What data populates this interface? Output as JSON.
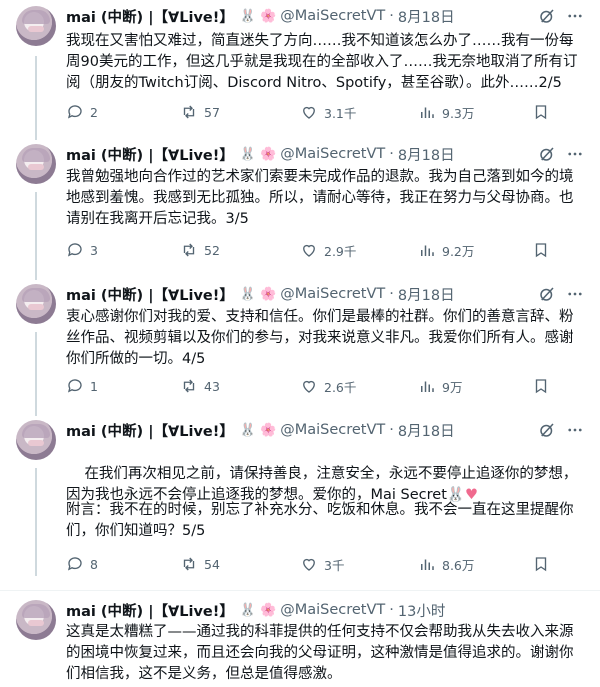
{
  "author": {
    "name": "mai (中断) |【∀Live!】",
    "rabbit_emoji": "🐰",
    "flower_emoji": "🌸",
    "handle": "@MaiSecretVT"
  },
  "tweets": [
    {
      "date": "8月18日",
      "text": "我现在又害怕又难过，简直迷失了方向……我不知道该怎么办了……我有一份每周90美元的工作，但这几乎就是我现在的全部收入了……我无奈地取消了所有订阅（朋友的Twitch订阅、Discord Nitro、Spotify，甚至谷歌）。此外……2/5",
      "replies": "2",
      "retweets": "57",
      "likes": "3.1千",
      "views": "9.3万"
    },
    {
      "date": "8月18日",
      "text": "我曾勉强地向合作过的艺术家们索要未完成作品的退款。我为自己落到如今的境地感到羞愧。我感到无比孤独。所以，请耐心等待，我正在努力与父母协商。也请别在我离开后忘记我。3/5",
      "replies": "3",
      "retweets": "52",
      "likes": "2.9千",
      "views": "9.2万"
    },
    {
      "date": "8月18日",
      "text": "衷心感谢你们对我的爱、支持和信任。你们是最棒的社群。你们的善意言辞、粉丝作品、视频剪辑以及你们的参与，对我来说意义非凡。我爱你们所有人。感谢你们所做的一切。4/5",
      "replies": "1",
      "retweets": "43",
      "likes": "2.6千",
      "views": "9万"
    },
    {
      "date": "8月18日",
      "text_line1": "在我们再次相见之前，请保持善良，注意安全，永远不要停止追逐你的梦想，因为我也永远不会停止追逐我的梦想。爱你的，Mai Secret",
      "text_emoji": "🐰",
      "text_heart": "♥",
      "text_line2": "附言：我不在的时候，别忘了补充水分、吃饭和休息。我不会一直在这里提醒你们，你们知道吗？5/5",
      "replies": "8",
      "retweets": "54",
      "likes": "3千",
      "views": "8.6万"
    },
    {
      "date": "13小时",
      "text": "这真是太糟糕了——通过我的科菲提供的任何支持不仅会帮助我从失去收入来源的困境中恢复过来，而且还会向我的父母证明，这种激情是值得追求的。谢谢你们相信我，这不是义务，但总是值得感激。"
    }
  ],
  "icons": {
    "reply": "reply-icon",
    "retweet": "retweet-icon",
    "like": "like-icon",
    "views": "views-icon",
    "bookmark": "bookmark-icon",
    "grok": "grok-icon",
    "more": "more-icon"
  },
  "colors": {
    "text": "#0f1419",
    "secondary": "#536471",
    "thread_line": "#cfd9de",
    "separator": "#eff3f4",
    "heart": "#f06a8e"
  }
}
